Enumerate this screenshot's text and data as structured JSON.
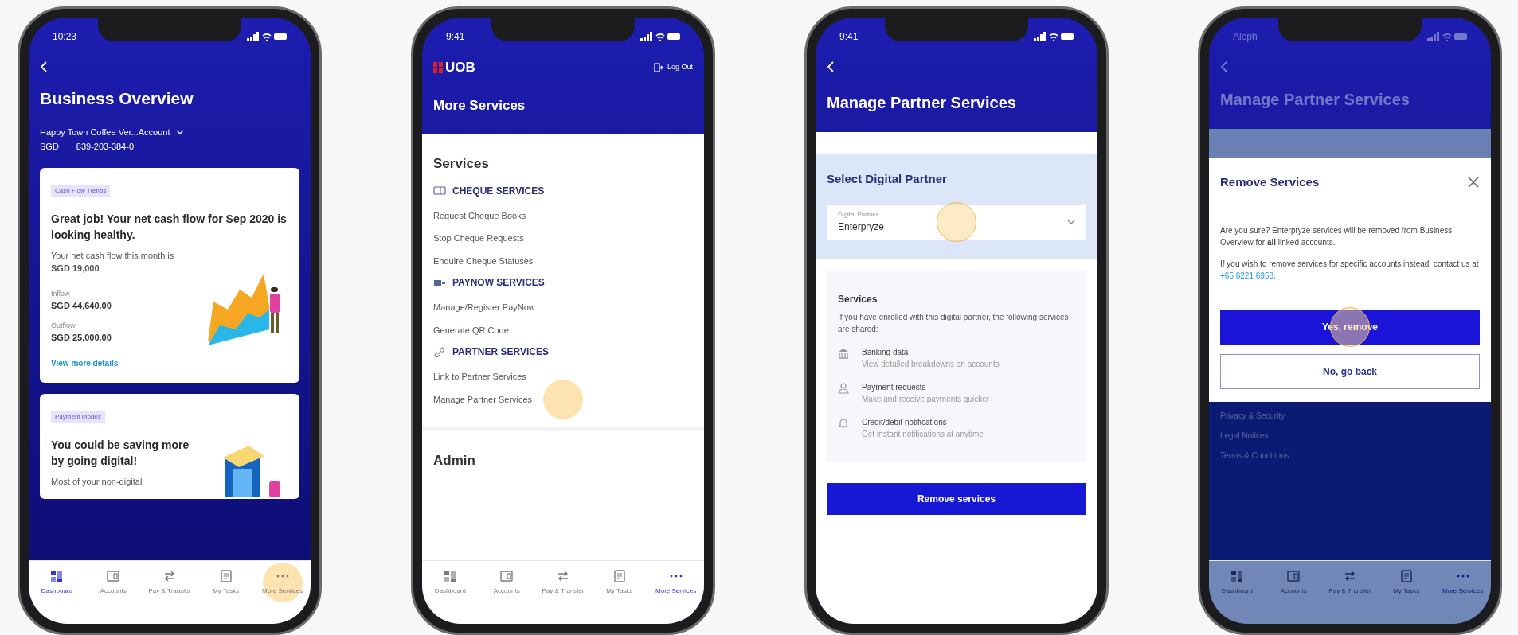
{
  "phones": [
    {
      "kind": "overview",
      "status_time": "10:23",
      "title": "Business Overview",
      "account_name": "Happy Town Coffee Ver...Account",
      "currency": "SGD",
      "account_number": "839-203-384-0",
      "cards": [
        {
          "kind": "chart",
          "tag": "Cash Flow Trends",
          "headline": "Great job! Your net cash flow for Sep 2020 is looking healthy.",
          "body": "Your net cash flow this month is **SGD 19,000**.",
          "figures": [
            {
              "label": "Inflow",
              "value": "SGD 44,640.00"
            },
            {
              "label": "Outflow",
              "value": "SGD 25,000.00"
            }
          ],
          "link": "View more details"
        },
        {
          "kind": "shop",
          "tag": "Payment Modes",
          "headline": "You could be saving more by going digital!",
          "body": "Most of your non-digital"
        }
      ],
      "nav": [
        {
          "kind": "dashboard",
          "label": "Dashboard",
          "selected": true,
          "tapped": false
        },
        {
          "kind": "accounts",
          "label": "Accounts",
          "selected": false,
          "tapped": false
        },
        {
          "kind": "transfer",
          "label": "Pay & Transfer",
          "selected": false,
          "tapped": false
        },
        {
          "kind": "tasks",
          "label": "My Tasks",
          "selected": false,
          "tapped": false
        },
        {
          "kind": "more",
          "label": "More Services",
          "selected": false,
          "tapped": true
        }
      ]
    },
    {
      "kind": "menu",
      "status_time": "9:41",
      "logo": "UOB",
      "logout": "Log Out",
      "title": "More Services",
      "section": "Services",
      "groups": [
        {
          "kind": "cheque",
          "heading": "CHEQUE SERVICES",
          "items": [
            {
              "label": "Request Cheque Books",
              "tapped": false
            },
            {
              "label": "Stop Cheque Requests",
              "tapped": false
            },
            {
              "label": "Enquire Cheque Statuses",
              "tapped": false
            }
          ]
        },
        {
          "kind": "paynow",
          "heading": "PAYNOW SERVICES",
          "items": [
            {
              "label": "Manage/Register PayNow",
              "tapped": false
            },
            {
              "label": "Generate QR Code",
              "tapped": false
            }
          ]
        },
        {
          "kind": "link",
          "heading": "PARTNER SERVICES",
          "items": [
            {
              "label": "Link to Partner Services",
              "tapped": false
            },
            {
              "label": "Manage Partner Services",
              "tapped": true
            }
          ]
        }
      ],
      "next_section": "Admin",
      "nav": [
        {
          "kind": "dashboard",
          "label": "Dashboard",
          "selected": false,
          "tapped": false
        },
        {
          "kind": "accounts",
          "label": "Accounts",
          "selected": false,
          "tapped": false
        },
        {
          "kind": "transfer",
          "label": "Pay & Transfer",
          "selected": false,
          "tapped": false
        },
        {
          "kind": "tasks",
          "label": "My Tasks",
          "selected": false,
          "tapped": false
        },
        {
          "kind": "more",
          "label": "More Services",
          "selected": true,
          "tapped": false
        }
      ]
    },
    {
      "kind": "manage",
      "status_time": "9:41",
      "title": "Manage Partner Services",
      "select_heading": "Select Digital Partner",
      "dropdown": {
        "label": "Digital Partner",
        "value": "Enterpryze",
        "tapped": true
      },
      "services_heading": "Services",
      "services_intro": "If you have enrolled with this digital partner, the following services are shared:",
      "services": [
        {
          "kind": "bank",
          "title": "Banking data",
          "description": "View detailed breakdowns on accounts"
        },
        {
          "kind": "payment",
          "title": "Payment requests",
          "description": "Make and receive payments quicker"
        },
        {
          "kind": "bell",
          "title": "Credit/debit notifications",
          "description": "Get instant notifications at anytime"
        }
      ],
      "button": {
        "label": "Remove services"
      }
    },
    {
      "kind": "modal",
      "status_time": "Aleph",
      "title": "Manage Partner Services",
      "modal": {
        "title": "Remove Services",
        "message": "Are you sure? Enterpryze services will be removed from Business Overview for **all** linked accounts.",
        "contact_text": "If you wish to remove services for specific accounts instead, contact us at",
        "phone": "+65 6221 6958.",
        "buttons": [
          {
            "kind": "primary",
            "label": "Yes, remove",
            "tapped": true
          },
          {
            "kind": "secondary",
            "label": "No, go back",
            "tapped": false
          }
        ]
      },
      "footer_links": [
        "Privacy & Security",
        "Legal Notices",
        "Terms & Conditions"
      ],
      "nav": [
        {
          "kind": "dashboard",
          "label": "Dashboard",
          "selected": false,
          "tapped": false
        },
        {
          "kind": "accounts",
          "label": "Accounts",
          "selected": false,
          "tapped": false
        },
        {
          "kind": "transfer",
          "label": "Pay & Transfer",
          "selected": false,
          "tapped": false
        },
        {
          "kind": "tasks",
          "label": "My Tasks",
          "selected": false,
          "tapped": false
        },
        {
          "kind": "more",
          "label": "More Services",
          "selected": true,
          "tapped": false
        }
      ]
    }
  ]
}
